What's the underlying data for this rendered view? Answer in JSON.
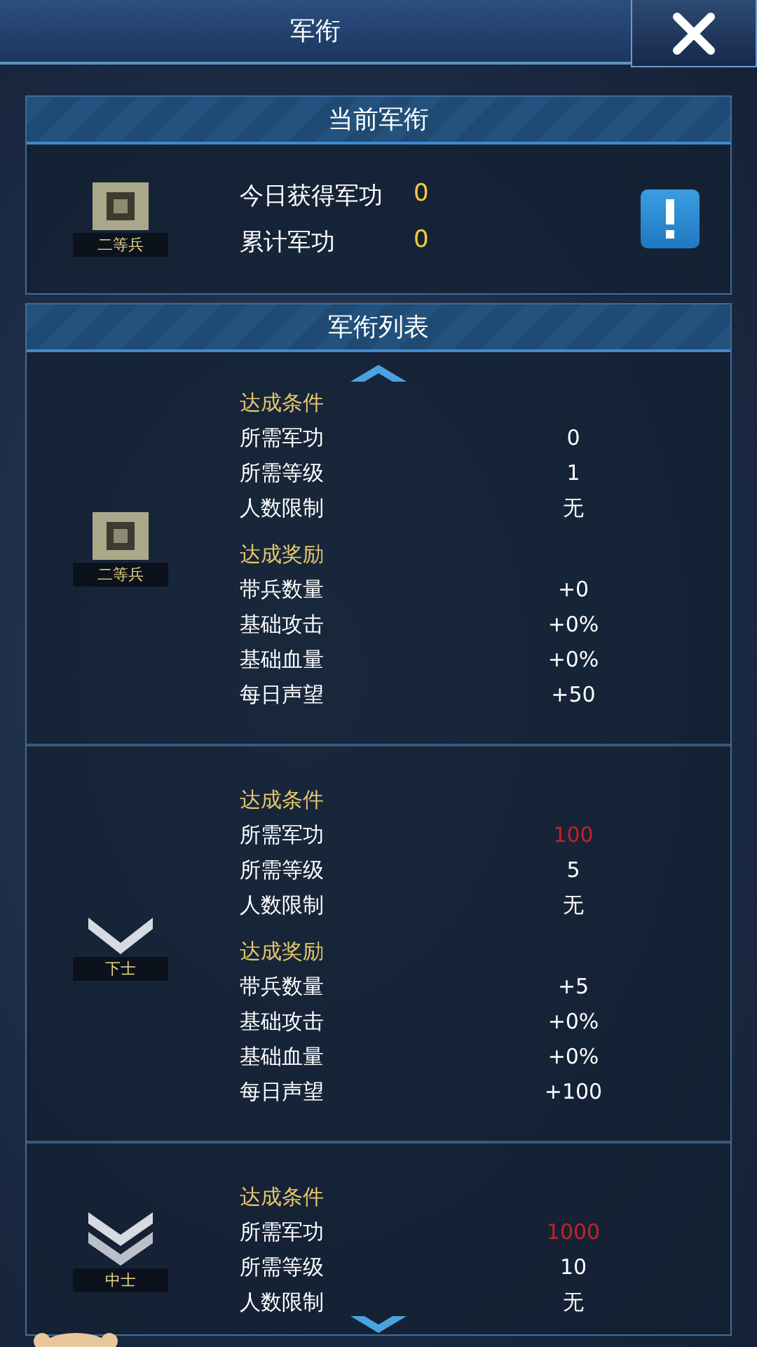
{
  "header": {
    "title": "军衔"
  },
  "current": {
    "title": "当前军衔",
    "badge": {
      "kind": "square",
      "name": "二等兵"
    },
    "stats": [
      {
        "label": "今日获得军功",
        "value": "0"
      },
      {
        "label": "累计军功",
        "value": "0"
      }
    ]
  },
  "list": {
    "title": "军衔列表",
    "ranks": [
      {
        "badge": {
          "kind": "square",
          "name": "二等兵"
        },
        "conditions_title": "达成条件",
        "conditions": [
          {
            "label": "所需军功",
            "value": "0",
            "met": true
          },
          {
            "label": "所需等级",
            "value": "1",
            "met": true
          },
          {
            "label": "人数限制",
            "value": "无",
            "met": true
          }
        ],
        "rewards_title": "达成奖励",
        "rewards": [
          {
            "label": "带兵数量",
            "value": "+0"
          },
          {
            "label": "基础攻击",
            "value": "+0%"
          },
          {
            "label": "基础血量",
            "value": "+0%"
          },
          {
            "label": "每日声望",
            "value": "+50"
          }
        ]
      },
      {
        "badge": {
          "kind": "chevron",
          "name": "下士"
        },
        "conditions_title": "达成条件",
        "conditions": [
          {
            "label": "所需军功",
            "value": "100",
            "met": false
          },
          {
            "label": "所需等级",
            "value": "5",
            "met": true
          },
          {
            "label": "人数限制",
            "value": "无",
            "met": true
          }
        ],
        "rewards_title": "达成奖励",
        "rewards": [
          {
            "label": "带兵数量",
            "value": "+5"
          },
          {
            "label": "基础攻击",
            "value": "+0%"
          },
          {
            "label": "基础血量",
            "value": "+0%"
          },
          {
            "label": "每日声望",
            "value": "+100"
          }
        ]
      },
      {
        "badge": {
          "kind": "double-chevron",
          "name": "中士"
        },
        "conditions_title": "达成条件",
        "conditions": [
          {
            "label": "所需军功",
            "value": "1000",
            "met": false
          },
          {
            "label": "所需等级",
            "value": "10",
            "met": true
          },
          {
            "label": "人数限制",
            "value": "无",
            "met": true
          }
        ]
      }
    ]
  }
}
